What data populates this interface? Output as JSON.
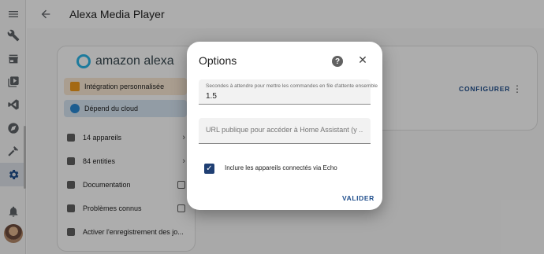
{
  "header": {
    "title": "Alexa Media Player"
  },
  "sidebar": {
    "icons": [
      "menu-icon",
      "wrench-icon",
      "store-icon",
      "media-icon",
      "vscode-icon",
      "compass-icon",
      "hammer-icon",
      "settings-icon",
      "bell-icon"
    ]
  },
  "integration": {
    "brand": "amazon alexa",
    "chips": [
      "Intégration personnalisée",
      "Dépend du cloud"
    ],
    "rows": [
      {
        "label": "14 appareils",
        "icon": "devices-icon",
        "end": "chevron"
      },
      {
        "label": "84 entities",
        "icon": "entities-icon",
        "end": "chevron"
      },
      {
        "label": "Documentation",
        "icon": "book-icon",
        "end": "external"
      },
      {
        "label": "Problèmes connus",
        "icon": "bug-icon",
        "end": "external"
      },
      {
        "label": "Activer l'enregistrement des jo...",
        "icon": "bug-icon",
        "end": ""
      }
    ],
    "configure_label": "CONFIGURER"
  },
  "dialog": {
    "title": "Options",
    "field1": {
      "label": "Secondes à attendre pour mettre les commandes en file d'attente ensemble",
      "value": "1.5"
    },
    "field2": {
      "placeholder": "URL publique pour accéder à Home Assistant (y ..."
    },
    "checkbox": {
      "label": "Inclure les appareils connectés via Echo",
      "checked": true
    },
    "submit_label": "VALIDER"
  },
  "colors": {
    "accent": "#1f4e8c",
    "alexa": "#2bb6e8"
  }
}
